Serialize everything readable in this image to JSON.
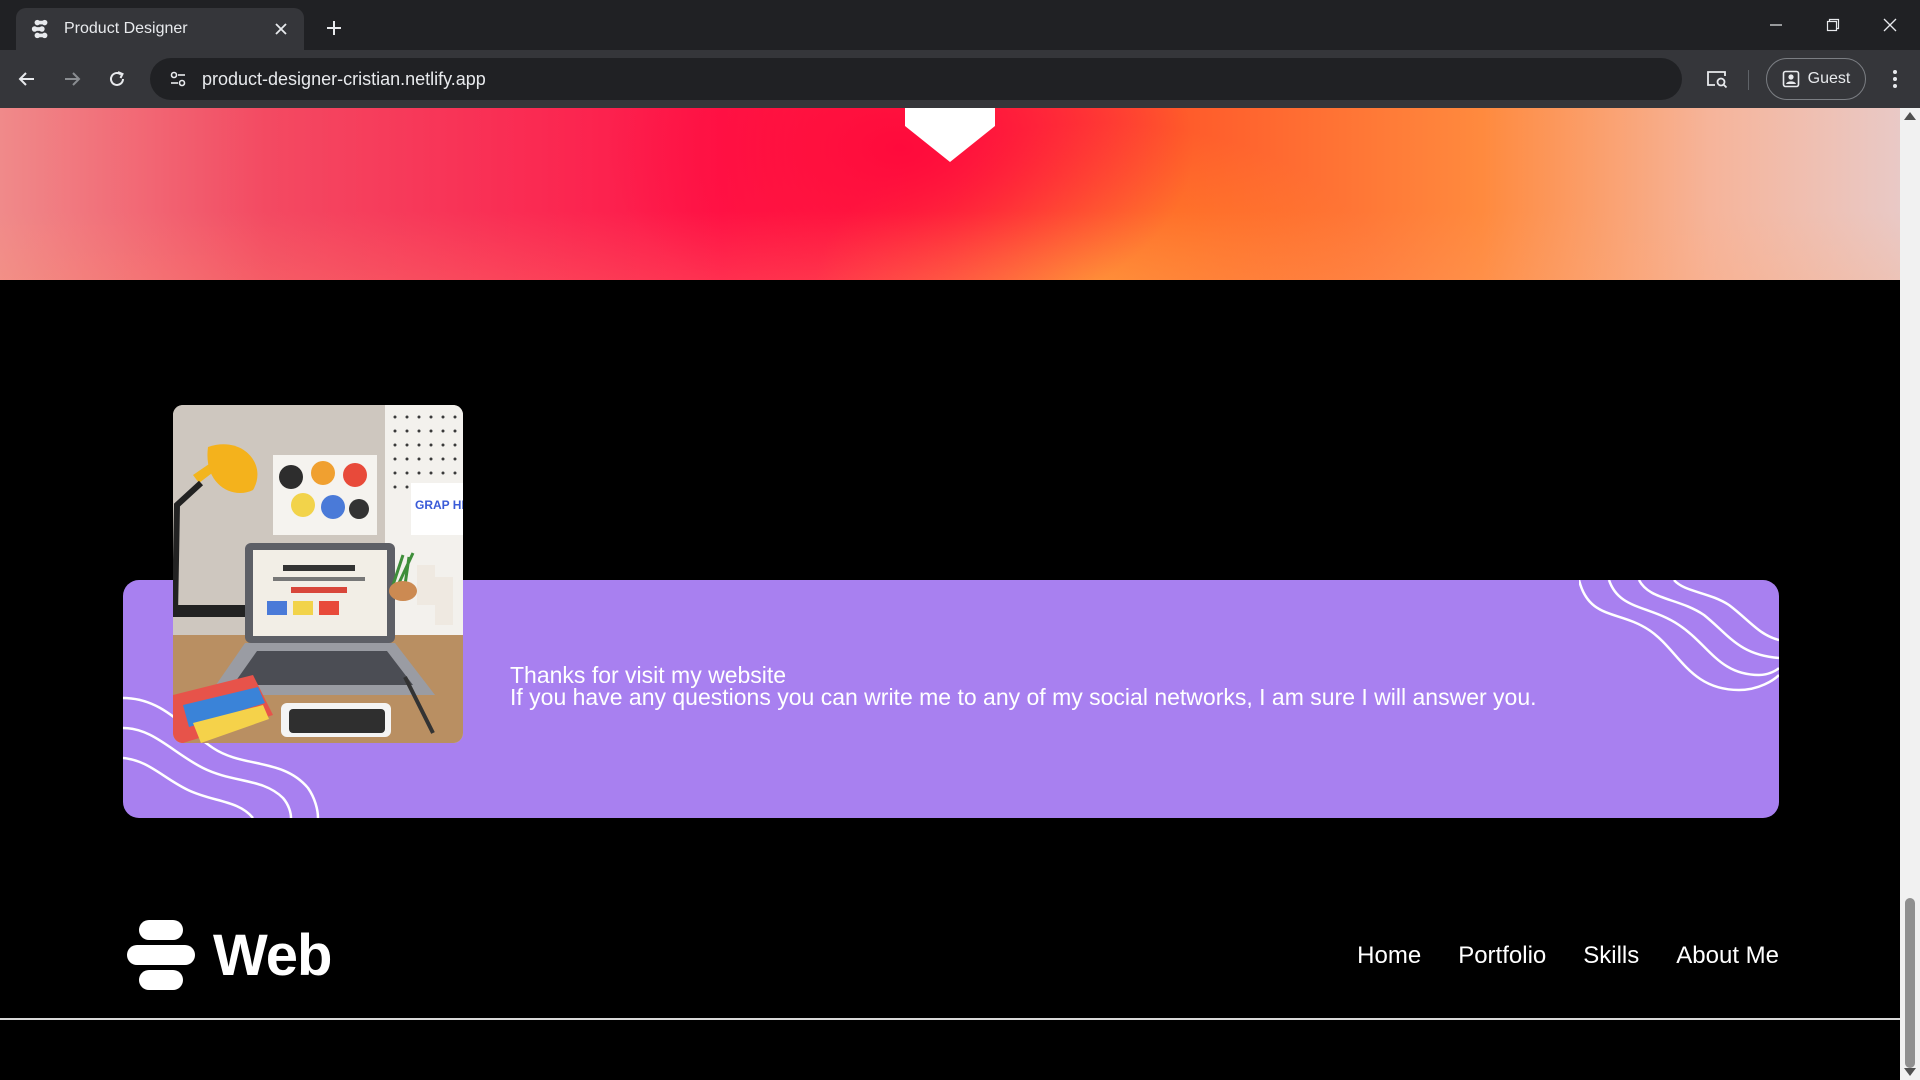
{
  "browser": {
    "tab_title": "Product Designer",
    "url": "product-designer-cristian.netlify.app",
    "profile_label": "Guest"
  },
  "icons": {
    "favicon": "molecule-logo-icon",
    "tab_close": "close-icon",
    "new_tab": "plus-icon",
    "back": "arrow-left-icon",
    "forward": "arrow-right-icon",
    "reload": "reload-icon",
    "site_info": "tune-icon",
    "cast": "cast-search-icon",
    "profile": "person-icon",
    "menu": "kebab-menu-icon"
  },
  "contact": {
    "line1": "Thanks for visit my website",
    "line2": "If you have any questions you can write me to any of my social networks, I am sure I will answer you."
  },
  "footer": {
    "brand": "Web",
    "nav": [
      "Home",
      "Portfolio",
      "Skills",
      "About Me"
    ]
  },
  "photo_sign": "GRAP HICS",
  "colors": {
    "card": "#a880f0",
    "page_bg": "#000000",
    "gradient_red": "#ff1447",
    "gradient_orange": "#ff8a3e"
  }
}
